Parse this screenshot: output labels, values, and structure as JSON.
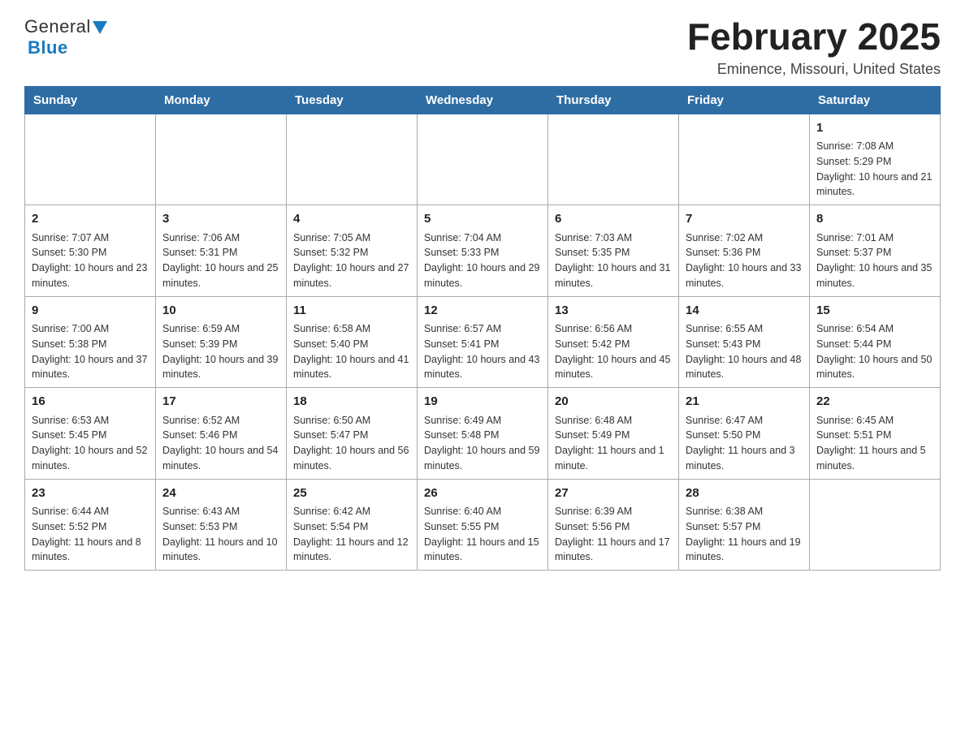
{
  "header": {
    "logo_general": "General",
    "logo_blue": "Blue",
    "title": "February 2025",
    "location": "Eminence, Missouri, United States"
  },
  "days_of_week": [
    "Sunday",
    "Monday",
    "Tuesday",
    "Wednesday",
    "Thursday",
    "Friday",
    "Saturday"
  ],
  "weeks": [
    {
      "days": [
        {
          "number": "",
          "sunrise": "",
          "sunset": "",
          "daylight": ""
        },
        {
          "number": "",
          "sunrise": "",
          "sunset": "",
          "daylight": ""
        },
        {
          "number": "",
          "sunrise": "",
          "sunset": "",
          "daylight": ""
        },
        {
          "number": "",
          "sunrise": "",
          "sunset": "",
          "daylight": ""
        },
        {
          "number": "",
          "sunrise": "",
          "sunset": "",
          "daylight": ""
        },
        {
          "number": "",
          "sunrise": "",
          "sunset": "",
          "daylight": ""
        },
        {
          "number": "1",
          "sunrise": "Sunrise: 7:08 AM",
          "sunset": "Sunset: 5:29 PM",
          "daylight": "Daylight: 10 hours and 21 minutes."
        }
      ]
    },
    {
      "days": [
        {
          "number": "2",
          "sunrise": "Sunrise: 7:07 AM",
          "sunset": "Sunset: 5:30 PM",
          "daylight": "Daylight: 10 hours and 23 minutes."
        },
        {
          "number": "3",
          "sunrise": "Sunrise: 7:06 AM",
          "sunset": "Sunset: 5:31 PM",
          "daylight": "Daylight: 10 hours and 25 minutes."
        },
        {
          "number": "4",
          "sunrise": "Sunrise: 7:05 AM",
          "sunset": "Sunset: 5:32 PM",
          "daylight": "Daylight: 10 hours and 27 minutes."
        },
        {
          "number": "5",
          "sunrise": "Sunrise: 7:04 AM",
          "sunset": "Sunset: 5:33 PM",
          "daylight": "Daylight: 10 hours and 29 minutes."
        },
        {
          "number": "6",
          "sunrise": "Sunrise: 7:03 AM",
          "sunset": "Sunset: 5:35 PM",
          "daylight": "Daylight: 10 hours and 31 minutes."
        },
        {
          "number": "7",
          "sunrise": "Sunrise: 7:02 AM",
          "sunset": "Sunset: 5:36 PM",
          "daylight": "Daylight: 10 hours and 33 minutes."
        },
        {
          "number": "8",
          "sunrise": "Sunrise: 7:01 AM",
          "sunset": "Sunset: 5:37 PM",
          "daylight": "Daylight: 10 hours and 35 minutes."
        }
      ]
    },
    {
      "days": [
        {
          "number": "9",
          "sunrise": "Sunrise: 7:00 AM",
          "sunset": "Sunset: 5:38 PM",
          "daylight": "Daylight: 10 hours and 37 minutes."
        },
        {
          "number": "10",
          "sunrise": "Sunrise: 6:59 AM",
          "sunset": "Sunset: 5:39 PM",
          "daylight": "Daylight: 10 hours and 39 minutes."
        },
        {
          "number": "11",
          "sunrise": "Sunrise: 6:58 AM",
          "sunset": "Sunset: 5:40 PM",
          "daylight": "Daylight: 10 hours and 41 minutes."
        },
        {
          "number": "12",
          "sunrise": "Sunrise: 6:57 AM",
          "sunset": "Sunset: 5:41 PM",
          "daylight": "Daylight: 10 hours and 43 minutes."
        },
        {
          "number": "13",
          "sunrise": "Sunrise: 6:56 AM",
          "sunset": "Sunset: 5:42 PM",
          "daylight": "Daylight: 10 hours and 45 minutes."
        },
        {
          "number": "14",
          "sunrise": "Sunrise: 6:55 AM",
          "sunset": "Sunset: 5:43 PM",
          "daylight": "Daylight: 10 hours and 48 minutes."
        },
        {
          "number": "15",
          "sunrise": "Sunrise: 6:54 AM",
          "sunset": "Sunset: 5:44 PM",
          "daylight": "Daylight: 10 hours and 50 minutes."
        }
      ]
    },
    {
      "days": [
        {
          "number": "16",
          "sunrise": "Sunrise: 6:53 AM",
          "sunset": "Sunset: 5:45 PM",
          "daylight": "Daylight: 10 hours and 52 minutes."
        },
        {
          "number": "17",
          "sunrise": "Sunrise: 6:52 AM",
          "sunset": "Sunset: 5:46 PM",
          "daylight": "Daylight: 10 hours and 54 minutes."
        },
        {
          "number": "18",
          "sunrise": "Sunrise: 6:50 AM",
          "sunset": "Sunset: 5:47 PM",
          "daylight": "Daylight: 10 hours and 56 minutes."
        },
        {
          "number": "19",
          "sunrise": "Sunrise: 6:49 AM",
          "sunset": "Sunset: 5:48 PM",
          "daylight": "Daylight: 10 hours and 59 minutes."
        },
        {
          "number": "20",
          "sunrise": "Sunrise: 6:48 AM",
          "sunset": "Sunset: 5:49 PM",
          "daylight": "Daylight: 11 hours and 1 minute."
        },
        {
          "number": "21",
          "sunrise": "Sunrise: 6:47 AM",
          "sunset": "Sunset: 5:50 PM",
          "daylight": "Daylight: 11 hours and 3 minutes."
        },
        {
          "number": "22",
          "sunrise": "Sunrise: 6:45 AM",
          "sunset": "Sunset: 5:51 PM",
          "daylight": "Daylight: 11 hours and 5 minutes."
        }
      ]
    },
    {
      "days": [
        {
          "number": "23",
          "sunrise": "Sunrise: 6:44 AM",
          "sunset": "Sunset: 5:52 PM",
          "daylight": "Daylight: 11 hours and 8 minutes."
        },
        {
          "number": "24",
          "sunrise": "Sunrise: 6:43 AM",
          "sunset": "Sunset: 5:53 PM",
          "daylight": "Daylight: 11 hours and 10 minutes."
        },
        {
          "number": "25",
          "sunrise": "Sunrise: 6:42 AM",
          "sunset": "Sunset: 5:54 PM",
          "daylight": "Daylight: 11 hours and 12 minutes."
        },
        {
          "number": "26",
          "sunrise": "Sunrise: 6:40 AM",
          "sunset": "Sunset: 5:55 PM",
          "daylight": "Daylight: 11 hours and 15 minutes."
        },
        {
          "number": "27",
          "sunrise": "Sunrise: 6:39 AM",
          "sunset": "Sunset: 5:56 PM",
          "daylight": "Daylight: 11 hours and 17 minutes."
        },
        {
          "number": "28",
          "sunrise": "Sunrise: 6:38 AM",
          "sunset": "Sunset: 5:57 PM",
          "daylight": "Daylight: 11 hours and 19 minutes."
        },
        {
          "number": "",
          "sunrise": "",
          "sunset": "",
          "daylight": ""
        }
      ]
    }
  ]
}
